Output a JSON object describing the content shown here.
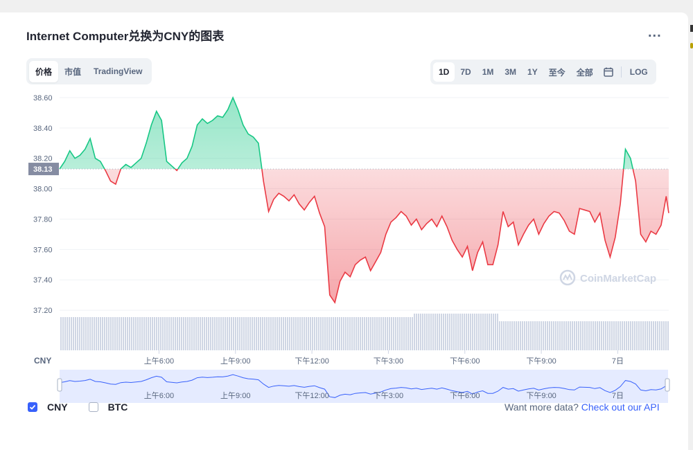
{
  "header": {
    "title": "Internet Computer兑换为CNY的图表",
    "more_label": "..."
  },
  "tabs": [
    {
      "label": "价格",
      "active": true
    },
    {
      "label": "市值",
      "active": false
    },
    {
      "label": "TradingView",
      "active": false
    }
  ],
  "ranges": [
    {
      "label": "1D",
      "active": true
    },
    {
      "label": "7D"
    },
    {
      "label": "1M"
    },
    {
      "label": "3M"
    },
    {
      "label": "1Y"
    },
    {
      "label": "至今"
    },
    {
      "label": "全部"
    }
  ],
  "log_label": "LOG",
  "watermark": "CoinMarketCap",
  "legend": {
    "cny": "CNY",
    "btc": "BTC"
  },
  "api": {
    "prefix": "Want more data? ",
    "link": "Check out our API"
  },
  "colors": {
    "up": "#16c784",
    "down": "#ea3943",
    "accent": "#3861fb",
    "volume": "#cfd6e4",
    "navigator": "#e5ebff"
  },
  "chart_data": {
    "type": "area",
    "currency_label": "CNY",
    "reference_value": 38.13,
    "reference_label": "38.13",
    "ylim": [
      37.1,
      38.65
    ],
    "y_ticks": [
      "37.20",
      "37.40",
      "37.60",
      "37.80",
      "38.00",
      "38.20",
      "38.40",
      "38.60"
    ],
    "x_ticks": [
      "上午6:00",
      "上午9:00",
      "下午12:00",
      "下午3:00",
      "下午6:00",
      "下午9:00",
      "7日"
    ],
    "x_tick_hours": [
      6,
      9,
      12,
      15,
      18,
      21,
      24
    ],
    "xlim_hours": [
      2.1,
      26.0
    ],
    "series": [
      {
        "hours": [
          2.1,
          2.3,
          2.5,
          2.7,
          2.9,
          3.1,
          3.3,
          3.5,
          3.7,
          3.9,
          4.1,
          4.3,
          4.5,
          4.7,
          4.9,
          5.1,
          5.3,
          5.5,
          5.7,
          5.9,
          6.1,
          6.3,
          6.5,
          6.7,
          6.9,
          7.1,
          7.3,
          7.5,
          7.7,
          7.9,
          8.1,
          8.3,
          8.5,
          8.7,
          8.9,
          9.1,
          9.3,
          9.5,
          9.7,
          9.9,
          10.1,
          10.3,
          10.5,
          10.7,
          10.9,
          11.1,
          11.3,
          11.5,
          11.7,
          11.9,
          12.1,
          12.3,
          12.5,
          12.7,
          12.9,
          13.1,
          13.3,
          13.5,
          13.7,
          13.9,
          14.1,
          14.3,
          14.5,
          14.7,
          14.9,
          15.1,
          15.3,
          15.5,
          15.7,
          15.9,
          16.1,
          16.3,
          16.5,
          16.7,
          16.9,
          17.1,
          17.3,
          17.5,
          17.7,
          17.9,
          18.1,
          18.3,
          18.5,
          18.7,
          18.9,
          19.1,
          19.3,
          19.5,
          19.7,
          19.9,
          20.1,
          20.3,
          20.5,
          20.7,
          20.9,
          21.1,
          21.3,
          21.5,
          21.7,
          21.9,
          22.1,
          22.3,
          22.5,
          22.7,
          22.9,
          23.1,
          23.3,
          23.5,
          23.7,
          23.9,
          24.1,
          24.3,
          24.5,
          24.7,
          24.9,
          25.1,
          25.3,
          25.5,
          25.7,
          25.9,
          26.0
        ],
        "values": [
          38.13,
          38.18,
          38.25,
          38.2,
          38.22,
          38.26,
          38.33,
          38.2,
          38.18,
          38.12,
          38.05,
          38.03,
          38.13,
          38.16,
          38.14,
          38.17,
          38.2,
          38.3,
          38.42,
          38.51,
          38.45,
          38.18,
          38.15,
          38.12,
          38.17,
          38.2,
          38.28,
          38.42,
          38.46,
          38.43,
          38.45,
          38.48,
          38.47,
          38.52,
          38.6,
          38.52,
          38.42,
          38.36,
          38.34,
          38.3,
          38.05,
          37.85,
          37.93,
          37.97,
          37.95,
          37.92,
          37.96,
          37.9,
          37.86,
          37.91,
          37.95,
          37.84,
          37.75,
          37.3,
          37.25,
          37.39,
          37.45,
          37.42,
          37.5,
          37.53,
          37.55,
          37.46,
          37.52,
          37.58,
          37.7,
          37.78,
          37.81,
          37.85,
          37.82,
          37.76,
          37.8,
          37.73,
          37.77,
          37.8,
          37.75,
          37.82,
          37.75,
          37.66,
          37.6,
          37.55,
          37.62,
          37.46,
          37.58,
          37.65,
          37.5,
          37.5,
          37.63,
          37.85,
          37.75,
          37.78,
          37.63,
          37.7,
          37.76,
          37.8,
          37.7,
          37.77,
          37.82,
          37.85,
          37.84,
          37.79,
          37.72,
          37.7,
          37.87,
          37.86,
          37.85,
          37.78,
          37.84,
          37.66,
          37.55,
          37.68,
          37.9,
          38.26,
          38.2,
          38.05,
          37.7,
          37.65,
          37.72,
          37.7,
          37.76,
          37.95,
          37.84,
          37.8,
          37.73,
          37.75,
          37.84,
          37.92,
          38.0,
          37.93,
          37.9
        ]
      }
    ]
  }
}
